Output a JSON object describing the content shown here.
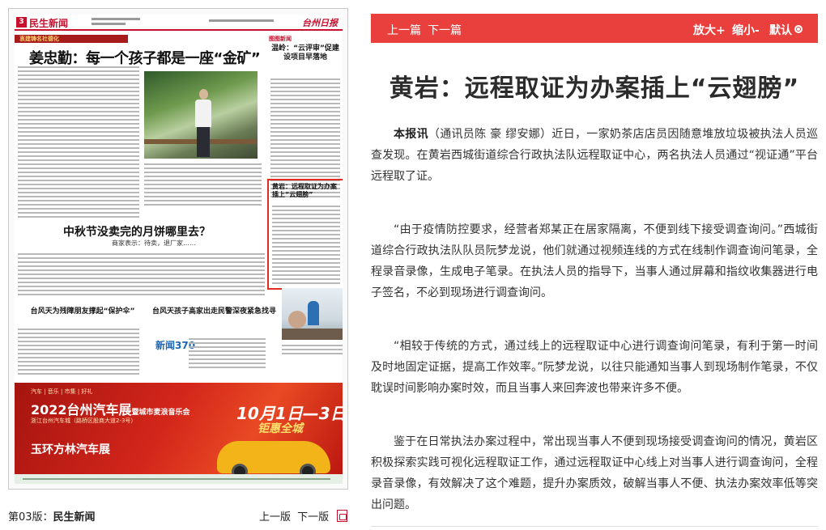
{
  "newspaper": {
    "page_number": "3",
    "section_title": "民生新闻",
    "logo_text": "台州日报",
    "ribbon_text": "衷建铸名社德化",
    "lead_headline": "姜忠勤：每一个孩子都是一座“金矿”",
    "side_tag": "图图新闻",
    "side_headline": "温岭：“云评审”促建设项目早落地",
    "mid_headline": "中秋节没卖完的月饼哪里去？",
    "mid_subtitle": "商家表示：待卖，退厂家……",
    "small_headline_left": "台风天为残障朋友撑起“保护伞”",
    "small_headline_right": "台风天孩子高家出走民警深夜紧急找寻",
    "selected_headline": "黄岩：远程取证为办案插上“云翅膀”",
    "brand_left": "新闻370",
    "ad": {
      "line1": "汽车 | 音乐 | 市集 | 好礼",
      "title": "2022台州汽车展",
      "title_suffix": "暨城市麦浪音乐会",
      "venue": "浙江台州汽车城（路桥区股商大道2-3号）",
      "sub_title": "玉环方林汽车展",
      "date": "10月1日—3日",
      "slogan": "钜惠全城"
    }
  },
  "page_info": {
    "label_prefix": "第03版：",
    "label_section": "民生新闻",
    "prev": "上一版",
    "next": "下一版"
  },
  "toolbar": {
    "prev_article": "上一篇",
    "next_article": "下一篇",
    "zoom_in": "放大+",
    "zoom_out": "缩小-",
    "default": "默认"
  },
  "article": {
    "title": "黄岩：远程取证为办案插上“云翅膀”",
    "lead_bold": "本报讯",
    "paragraphs": [
      "（通讯员陈 豪 缪安娜）近日，一家奶茶店店员因随意堆放垃圾被执法人员巡查发现。在黄岩西城街道综合行政执法队远程取证中心，两名执法人员通过“视证通”平台远程取了证。",
      "“由于疫情防控要求，经营者郑某正在居家隔离，不便到线下接受调查询问。”西城街道综合行政执法队队员阮梦龙说，他们就通过视频连线的方式在线制作调查询问笔录，全程录音录像，生成电子笔录。在执法人员的指导下，当事人通过屏幕和指纹收集器进行电子签名，不必到现场进行调查询问。",
      "“相较于传统的方式，通过线上的远程取证中心进行调查询问笔录，有利于第一时间及时地固定证据，提高工作效率。”阮梦龙说，以往只能通知当事人到现场制作笔录，不仅耽误时间影响办案时效，而且当事人来回奔波也带来许多不便。",
      "鉴于在日常执法办案过程中，常出现当事人不便到现场接受调查询问的情况，黄岩区积极探索实践可视化远程取证工作，通过远程取证中心线上对当事人进行调查询问，全程录音录像，有效解决了这个难题，提升办案质效，破解当事人不便、执法办案效率低等突出问题。"
    ]
  },
  "colors": {
    "toolbar_bg": "#e9403d",
    "highlight_border": "#e32b22",
    "brand_red": "#c8102e"
  }
}
